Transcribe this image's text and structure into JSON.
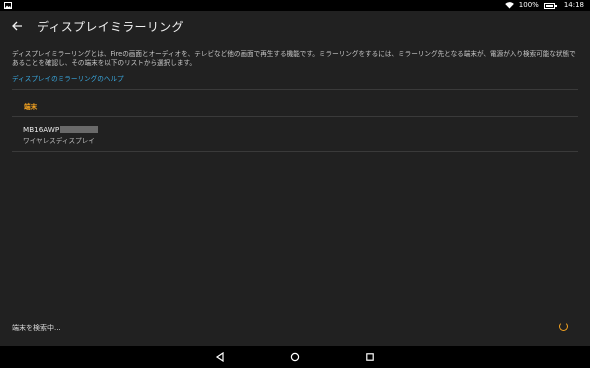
{
  "status_bar": {
    "battery": "100%",
    "time": "14:18"
  },
  "app_bar": {
    "title": "ディスプレイミラーリング",
    "back_icon": "arrow-back-icon"
  },
  "description": "ディスプレイミラーリングとは、Fireの画面とオーディオを、テレビなど他の画面で再生する機能です。ミラーリングをするには、ミラーリング先となる端末が、電源が入り検索可能な状態であることを確認し、その端末を以下のリストから選択します。",
  "help_link": "ディスプレイのミラーリングのヘルプ",
  "devices_section": {
    "header": "端末",
    "items": [
      {
        "name": "MB16AWP",
        "subtitle": "ワイヤレスディスプレイ"
      }
    ]
  },
  "search_status": "端末を検索中...",
  "colors": {
    "accent": "#f0a020",
    "link": "#39a8df",
    "background": "#212121"
  }
}
